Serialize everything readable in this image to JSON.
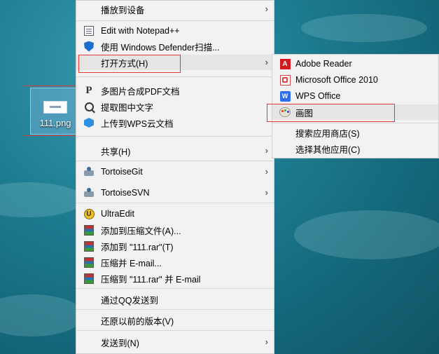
{
  "desktop": {
    "icon_label": "111.png"
  },
  "context_menu": {
    "items": [
      {
        "label": "播放到设备",
        "icon": "none",
        "has_submenu": true
      },
      {
        "label": "Edit with Notepad++",
        "icon": "notepadpp-icon",
        "has_submenu": false
      },
      {
        "label": "使用 Windows Defender扫描...",
        "icon": "defender-shield-icon",
        "has_submenu": false
      },
      {
        "label": "打开方式(H)",
        "icon": "none",
        "has_submenu": true,
        "highlighted": true
      },
      {
        "label": "多图片合成PDF文档",
        "icon": "pdf-icon",
        "has_submenu": false
      },
      {
        "label": "提取图中文字",
        "icon": "ocr-icon",
        "has_submenu": false
      },
      {
        "label": "上传到WPS云文档",
        "icon": "wps-cloud-icon",
        "has_submenu": false
      },
      {
        "label": "共享(H)",
        "icon": "none",
        "has_submenu": true
      },
      {
        "label": "TortoiseGit",
        "icon": "tortoisegit-icon",
        "has_submenu": true
      },
      {
        "label": "TortoiseSVN",
        "icon": "tortoisesvn-icon",
        "has_submenu": true
      },
      {
        "label": "UltraEdit",
        "icon": "ultraedit-icon",
        "has_submenu": false
      },
      {
        "label": "添加到压缩文件(A)...",
        "icon": "winrar-icon",
        "has_submenu": false
      },
      {
        "label": "添加到 \"111.rar\"(T)",
        "icon": "winrar-icon",
        "has_submenu": false
      },
      {
        "label": "压缩并 E-mail...",
        "icon": "winrar-icon",
        "has_submenu": false
      },
      {
        "label": "压缩到 \"111.rar\" 并 E-mail",
        "icon": "winrar-icon",
        "has_submenu": false
      },
      {
        "label": "通过QQ发送到",
        "icon": "none",
        "has_submenu": false
      },
      {
        "label": "还原以前的版本(V)",
        "icon": "none",
        "has_submenu": false
      },
      {
        "label": "发送到(N)",
        "icon": "none",
        "has_submenu": true
      }
    ]
  },
  "open_with_submenu": {
    "items": [
      {
        "label": "Adobe Reader",
        "icon": "adobe-reader-icon"
      },
      {
        "label": "Microsoft Office 2010",
        "icon": "office-icon"
      },
      {
        "label": "WPS Office",
        "icon": "wps-icon"
      },
      {
        "label": "画图",
        "icon": "paint-icon",
        "highlighted": true
      },
      {
        "label": "搜索应用商店(S)",
        "icon": "none"
      },
      {
        "label": "选择其他应用(C)",
        "icon": "none"
      }
    ]
  },
  "arrow_glyph": "›",
  "colors": {
    "highlight_box": "#e23a3a",
    "menu_bg": "#f2f2f2",
    "hover_bg": "#e5e5e5"
  }
}
